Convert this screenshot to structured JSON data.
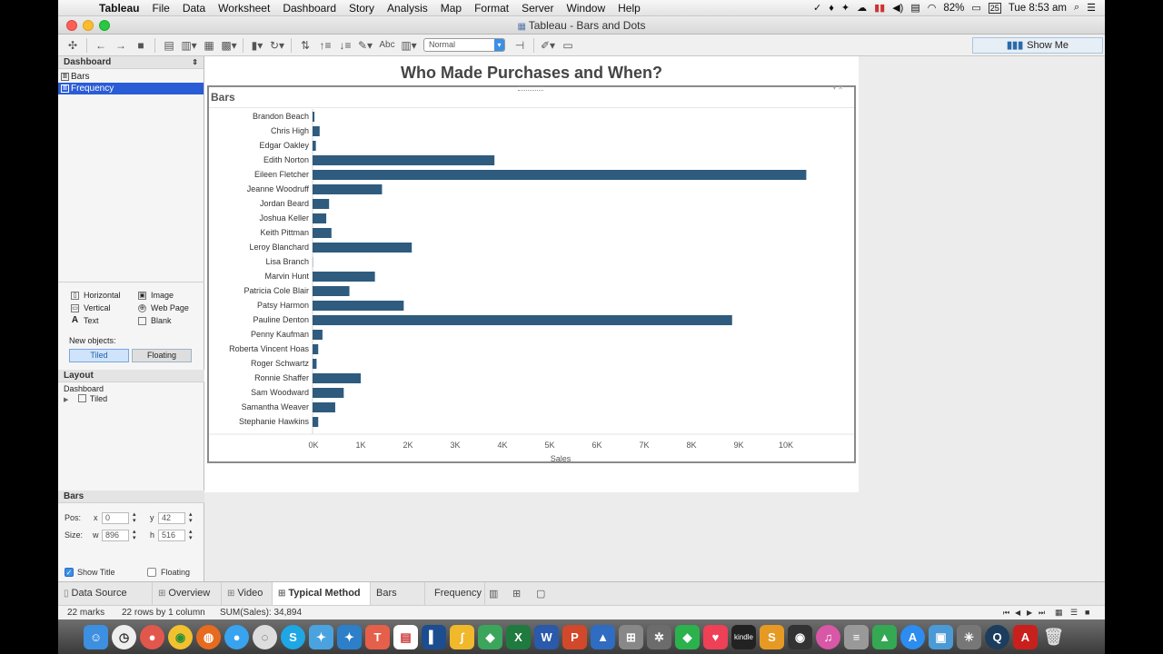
{
  "menubar": {
    "app": "Tableau",
    "items": [
      "File",
      "Data",
      "Worksheet",
      "Dashboard",
      "Story",
      "Analysis",
      "Map",
      "Format",
      "Server",
      "Window",
      "Help"
    ],
    "battery": "82%",
    "clock": "Tue 8:53 am",
    "date_icon": "25"
  },
  "window": {
    "title": "Tableau - Bars and Dots"
  },
  "toolbar": {
    "fit_value": "Normal",
    "abc_label": "Abc",
    "show_me": "Show Me"
  },
  "left_panel": {
    "header": "Dashboard",
    "sheets": [
      {
        "label": "Bars",
        "selected": false
      },
      {
        "label": "Frequency",
        "selected": true
      }
    ],
    "objects": {
      "horizontal": "Horizontal",
      "vertical": "Vertical",
      "text": "Text",
      "image": "Image",
      "web_page": "Web Page",
      "blank": "Blank"
    },
    "new_objects_label": "New objects:",
    "tiled": "Tiled",
    "floating": "Floating",
    "layout_header": "Layout",
    "layout_root": "Dashboard",
    "layout_child": "Tiled",
    "bars_header": "Bars",
    "pos_label": "Pos:",
    "size_label": "Size:",
    "x_label": "x",
    "y_label": "y",
    "w_label": "w",
    "h_label": "h",
    "x_value": "0",
    "y_value": "42",
    "w_value": "896",
    "h_value": "516",
    "show_title_label": "Show Title",
    "show_title_checked": true,
    "floating_label": "Floating",
    "floating_checked": false
  },
  "dashboard": {
    "title": "Who Made Purchases and When?",
    "worksheet_title": "Bars"
  },
  "chart_data": {
    "type": "bar",
    "orientation": "horizontal",
    "categories": [
      "Brandon Beach",
      "Chris High",
      "Edgar Oakley",
      "Edith Norton",
      "Eileen Fletcher",
      "Jeanne Woodruff",
      "Jordan Beard",
      "Joshua Keller",
      "Keith Pittman",
      "Leroy Blanchard",
      "Lisa Branch",
      "Marvin Hunt",
      "Patricia Cole Blair",
      "Patsy Harmon",
      "Pauline Denton",
      "Penny Kaufman",
      "Roberta Vincent Hoas",
      "Roger Schwartz",
      "Ronnie Shaffer",
      "Sam Woodward",
      "Samantha Weaver",
      "Stephanie Hawkins"
    ],
    "values": [
      40,
      150,
      70,
      3850,
      10450,
      1470,
      350,
      290,
      400,
      2100,
      5,
      1320,
      780,
      1930,
      8880,
      210,
      120,
      85,
      1020,
      660,
      480,
      120
    ],
    "xlabel": "Sales",
    "ylabel": "",
    "xlim": [
      0,
      10500
    ],
    "ticks": [
      0,
      1000,
      2000,
      3000,
      4000,
      5000,
      6000,
      7000,
      8000,
      9000,
      10000
    ],
    "tick_labels": [
      "0K",
      "1K",
      "2K",
      "3K",
      "4K",
      "5K",
      "6K",
      "7K",
      "8K",
      "9K",
      "10K"
    ],
    "bar_color": "#2e5b7e",
    "grid": false
  },
  "tabs": [
    {
      "label": "Data Source",
      "icon": "database-icon"
    },
    {
      "label": "Overview",
      "icon": "grid-icon"
    },
    {
      "label": "Video",
      "icon": "grid-icon"
    },
    {
      "label": "Typical Method",
      "icon": "grid-icon",
      "active": true
    },
    {
      "label": "Bars",
      "icon": ""
    },
    {
      "label": "Frequency",
      "icon": ""
    }
  ],
  "status": {
    "marks": "22 marks",
    "rows_cols": "22 rows by 1 column",
    "sum": "SUM(Sales): 34,894"
  },
  "dock": {
    "kindle_label": "kindle"
  }
}
